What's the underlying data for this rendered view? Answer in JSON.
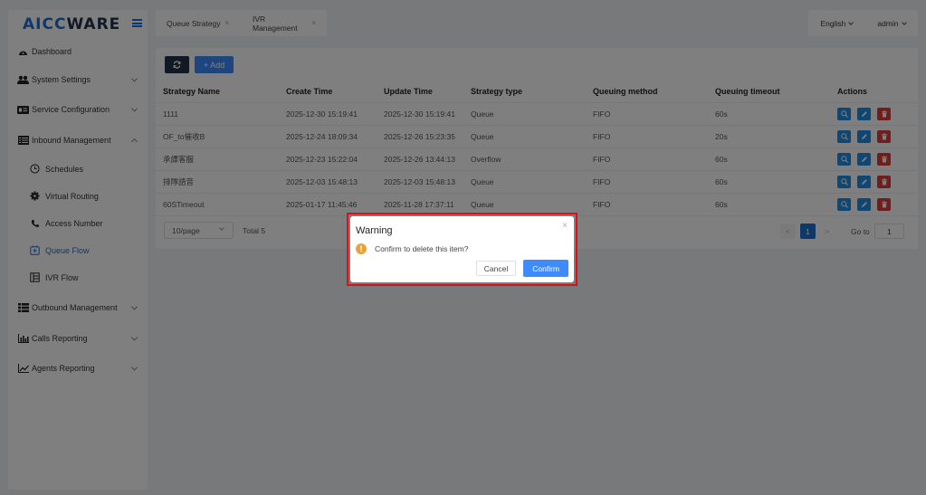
{
  "brand": {
    "logo_part1": "AICC",
    "logo_part2": "WARE"
  },
  "sidebar": {
    "items": [
      {
        "label": "Dashboard"
      },
      {
        "label": "System Settings"
      },
      {
        "label": "Service Configuration"
      },
      {
        "label": "Inbound Management"
      },
      {
        "label": "Outbound Management"
      },
      {
        "label": "Calls Reporting"
      },
      {
        "label": "Agents Reporting"
      }
    ],
    "inbound_sub": [
      {
        "label": "Schedules"
      },
      {
        "label": "Virtual Routing"
      },
      {
        "label": "Access Number"
      },
      {
        "label": "Queue Flow"
      },
      {
        "label": "IVR Flow"
      }
    ]
  },
  "tabs": [
    {
      "label": "Queue Strategy",
      "close": "×"
    },
    {
      "label": "IVR Management",
      "close": "×"
    }
  ],
  "header": {
    "language": "English",
    "user": "admin"
  },
  "toolbar": {
    "add_label": "+ Add"
  },
  "table": {
    "columns": [
      "Strategy Name",
      "Create Time",
      "Update Time",
      "Strategy type",
      "Queuing method",
      "Queuing timeout",
      "Actions"
    ],
    "rows": [
      [
        "1111",
        "2025-12-30 15:19:41",
        "2025-12-30 15:19:41",
        "Queue",
        "FIFO",
        "60s"
      ],
      [
        "OF_to催收B",
        "2025-12-24 18:09:34",
        "2025-12-26 15:23:35",
        "Queue",
        "FIFO",
        "20s"
      ],
      [
        "承譯客服",
        "2025-12-23 15:22:04",
        "2025-12-26 13:44:13",
        "Overflow",
        "FIFO",
        "60s"
      ],
      [
        "排隊語音",
        "2025-12-03 15:48:13",
        "2025-12-03 15:48:13",
        "Queue",
        "FIFO",
        "60s"
      ],
      [
        "60STimeout",
        "2025-01-17 11:45:46",
        "2025-11-28 17:37:11",
        "Queue",
        "FIFO",
        "60s"
      ]
    ]
  },
  "pagination": {
    "page_size": "10/page",
    "total": "Total 5",
    "prev": "<",
    "current": "1",
    "next": ">",
    "goto_label": "Go to",
    "goto_value": "1"
  },
  "dialog": {
    "title": "Warning",
    "close": "×",
    "icon": "!",
    "message": "Confirm to delete this item?",
    "cancel": "Cancel",
    "confirm": "Confirm"
  },
  "colors": {
    "accent": "#1f6fd2",
    "danger": "#e03a3a",
    "warning": "#e6a23c",
    "highlight_border": "#d8121b"
  }
}
